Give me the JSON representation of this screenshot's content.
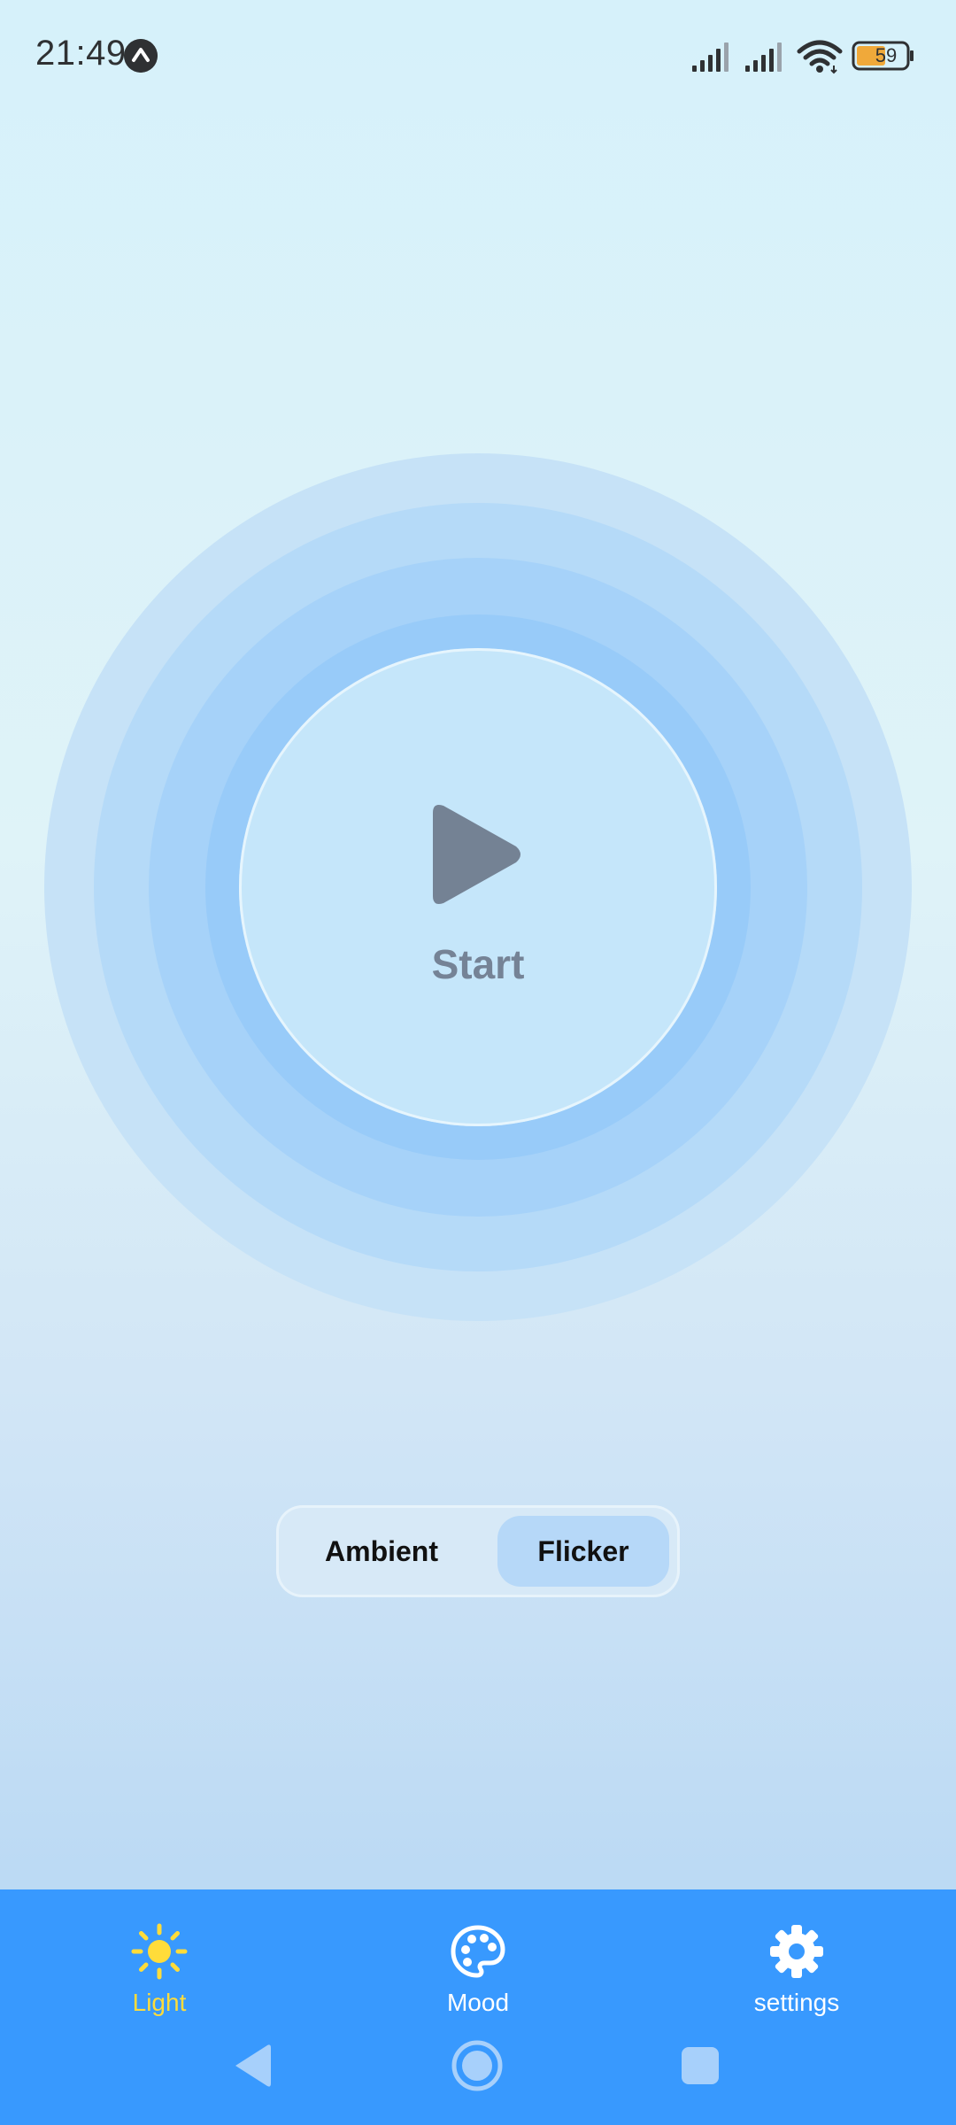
{
  "status_bar": {
    "time": "21:49",
    "battery_level": "59",
    "notification_icon": "caret-up-circle-icon",
    "signal_icons": [
      "signal-bars-icon",
      "signal-bars-icon"
    ],
    "wifi_icon": "wifi-icon",
    "battery_icon": "battery-icon"
  },
  "main": {
    "start_label": "Start",
    "play_icon": "play-icon"
  },
  "mode_toggle": {
    "options": [
      {
        "label": "Ambient",
        "selected": false
      },
      {
        "label": "Flicker",
        "selected": true
      }
    ]
  },
  "bottom_nav": {
    "items": [
      {
        "label": "Light",
        "icon": "sun-icon",
        "active": true
      },
      {
        "label": "Mood",
        "icon": "palette-icon",
        "active": false
      },
      {
        "label": "settings",
        "icon": "gear-icon",
        "active": false
      }
    ]
  },
  "system_nav": {
    "buttons": [
      "back-icon",
      "home-icon",
      "recents-icon"
    ]
  },
  "colors": {
    "nav_bar": "#3899fe",
    "active_nav": "#ffdc3a",
    "start_text": "#758396",
    "toggle_selected": "#b6d8f8"
  }
}
